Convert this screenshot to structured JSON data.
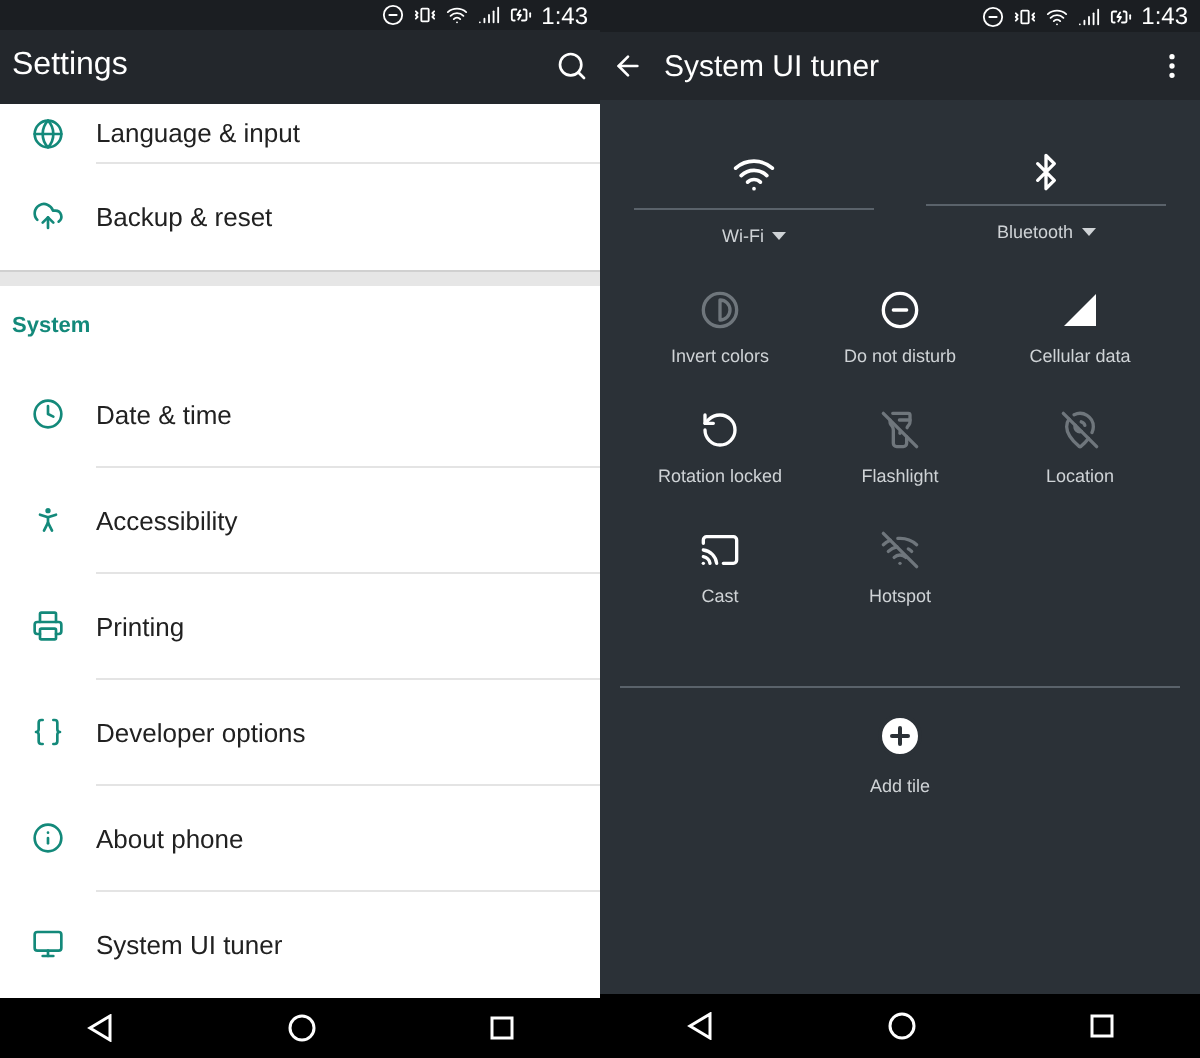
{
  "left": {
    "status_bar": {
      "time": "1:43"
    },
    "toolbar": {
      "title": "Settings"
    },
    "sections": [
      {
        "items": [
          {
            "label": "Language & input"
          },
          {
            "label": "Backup & reset"
          }
        ]
      },
      {
        "header": "System",
        "items": [
          {
            "label": "Date & time"
          },
          {
            "label": "Accessibility"
          },
          {
            "label": "Printing"
          },
          {
            "label": "Developer options"
          },
          {
            "label": "About phone"
          },
          {
            "label": "System UI tuner"
          }
        ]
      }
    ]
  },
  "right": {
    "status_bar": {
      "time": "1:43"
    },
    "toolbar": {
      "title": "System UI tuner"
    },
    "wide_tiles": [
      {
        "label": "Wi-Fi"
      },
      {
        "label": "Bluetooth"
      }
    ],
    "tiles": [
      {
        "label": "Invert colors",
        "on": false
      },
      {
        "label": "Do not disturb",
        "on": true
      },
      {
        "label": "Cellular data",
        "on": true
      },
      {
        "label": "Rotation locked",
        "on": true
      },
      {
        "label": "Flashlight",
        "on": false
      },
      {
        "label": "Location",
        "on": false
      },
      {
        "label": "Cast",
        "on": true
      },
      {
        "label": "Hotspot",
        "on": false
      }
    ],
    "add_tile": {
      "label": "Add tile"
    }
  }
}
